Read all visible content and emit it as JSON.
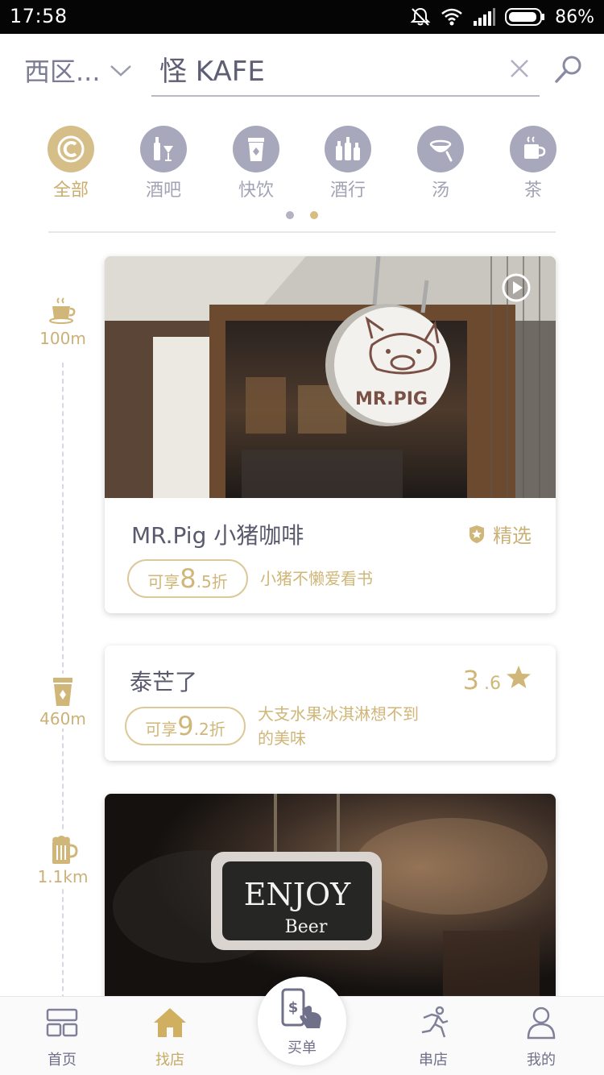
{
  "status_bar": {
    "time": "17:58",
    "battery": "86%"
  },
  "header": {
    "region": "西区...",
    "search_value": "怪 KAFE"
  },
  "categories": [
    {
      "label": "全部",
      "icon": "copyright-icon",
      "active": true
    },
    {
      "label": "酒吧",
      "icon": "bar-drinks-icon",
      "active": false
    },
    {
      "label": "快饮",
      "icon": "takeaway-cup-icon",
      "active": false
    },
    {
      "label": "酒行",
      "icon": "bottles-icon",
      "active": false
    },
    {
      "label": "汤",
      "icon": "soup-bowl-icon",
      "active": false
    },
    {
      "label": "茶",
      "icon": "tea-cup-icon",
      "active": false
    }
  ],
  "pagination": {
    "pages": 2,
    "current": 2
  },
  "timeline": [
    {
      "distance": "100m",
      "icon": "coffee-cup-icon"
    },
    {
      "distance": "460m",
      "icon": "takeaway-cup-icon"
    },
    {
      "distance": "1.1km",
      "icon": "beer-mug-icon"
    }
  ],
  "cards": [
    {
      "name": "MR.Pig 小猪咖啡",
      "badge": "精选",
      "discount_prefix": "可享",
      "discount_big": "8",
      "discount_small": ".5折",
      "description": "小猪不懒爱看书",
      "photo_sign_text": "MR.PIG"
    },
    {
      "name": "泰芒了",
      "rating_big": "3",
      "rating_small": ".6",
      "discount_prefix": "可享",
      "discount_big": "9",
      "discount_small": ".2折",
      "description_line1": "大支水果冰淇淋想不到",
      "description_line2": "的美味"
    },
    {
      "photo_sign_line1": "ENJOY",
      "photo_sign_line2": "Beer"
    }
  ],
  "bottom_nav": [
    {
      "label": "首页",
      "icon": "home-grid-icon"
    },
    {
      "label": "找店",
      "icon": "house-icon",
      "active": true
    },
    {
      "label": "买单",
      "icon": "phone-pay-icon"
    },
    {
      "label": "串店",
      "icon": "running-man-icon"
    },
    {
      "label": "我的",
      "icon": "person-icon"
    }
  ],
  "colors": {
    "accent": "#d0b678",
    "muted": "#a8a8bc",
    "text": "#5a5a6e"
  }
}
